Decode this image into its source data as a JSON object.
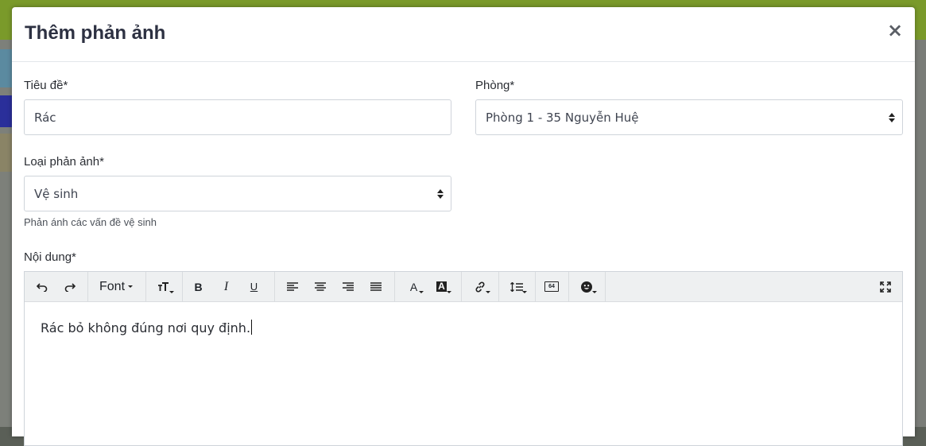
{
  "modal": {
    "title": "Thêm phản ảnh",
    "close_label": "×"
  },
  "form": {
    "title_field": {
      "label": "Tiêu đề*",
      "value": "Rác"
    },
    "room_field": {
      "label": "Phòng*",
      "value": "Phòng 1 - 35 Nguyễn Huệ"
    },
    "type_field": {
      "label": "Loại phản ảnh*",
      "value": "Vệ sinh",
      "hint": "Phản ánh các vấn đề vệ sinh"
    },
    "content_field": {
      "label": "Nội dung*",
      "value": "Rác bỏ không đúng nơi quy định."
    }
  },
  "toolbar": {
    "font_label": "Font",
    "bold_label": "B",
    "italic_label": "I",
    "underline_label": "U",
    "font_color_label": "A",
    "highlight_label": "A",
    "base64_label": "64",
    "icons": [
      "undo-icon",
      "redo-icon",
      "text-size-icon",
      "align-left-icon",
      "align-center-icon",
      "align-right-icon",
      "justify-icon",
      "link-icon",
      "line-height-icon",
      "emoji-icon",
      "fullscreen-icon"
    ]
  },
  "colors": {
    "title": "#2d3142",
    "border": "#cfd4da",
    "toolbar_bg": "#eef0f1",
    "backdrop_topbar": "#7a9a2a"
  }
}
